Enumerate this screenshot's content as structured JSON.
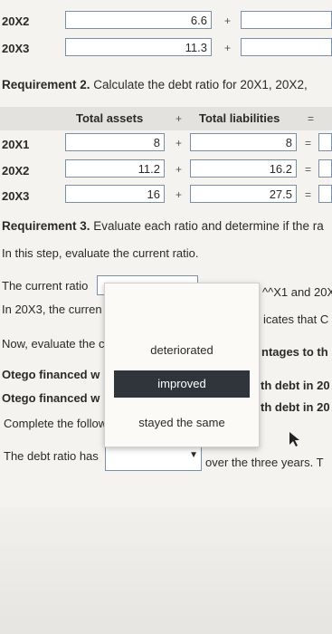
{
  "rows_top": [
    {
      "label": "20X2",
      "value": "6.6",
      "op": "+"
    },
    {
      "label": "20X3",
      "value": "11.3",
      "op": "+"
    }
  ],
  "req2": {
    "prefix": "Requirement 2.",
    "text": "Calculate the debt ratio for 20X1, 20X2,",
    "col_assets": "Total assets",
    "col_plus": "+",
    "col_liab": "Total liabilities",
    "col_eq": "=",
    "rows": [
      {
        "label": "20X1",
        "assets": "8",
        "liab": "8"
      },
      {
        "label": "20X2",
        "assets": "11.2",
        "liab": "16.2"
      },
      {
        "label": "20X3",
        "assets": "16",
        "liab": "27.5"
      }
    ]
  },
  "req3": {
    "prefix": "Requirement 3.",
    "text": "Evaluate each ratio and determine if the ra",
    "step": "In this step, evaluate the current ratio.",
    "current_ratio_label": "The current ratio",
    "current_ratio_after": "^^X1 and 20X",
    "in_20x3": "In 20X3, the curren",
    "indicates": "icates that C",
    "evaluate": "Now, evaluate the c",
    "advantages": "ntages to th",
    "otego1": "Otego financed w",
    "otego1_after": "th debt in 20",
    "otego2": "Otego financed w",
    "otego2_after": "th debt in 20",
    "complete": "Complete the follow",
    "debt_ratio_has": "The debt ratio has",
    "over_years": "over the three years. T"
  },
  "dropdown": {
    "options": [
      "deteriorated",
      "improved",
      "stayed the same"
    ],
    "highlighted": "improved"
  }
}
